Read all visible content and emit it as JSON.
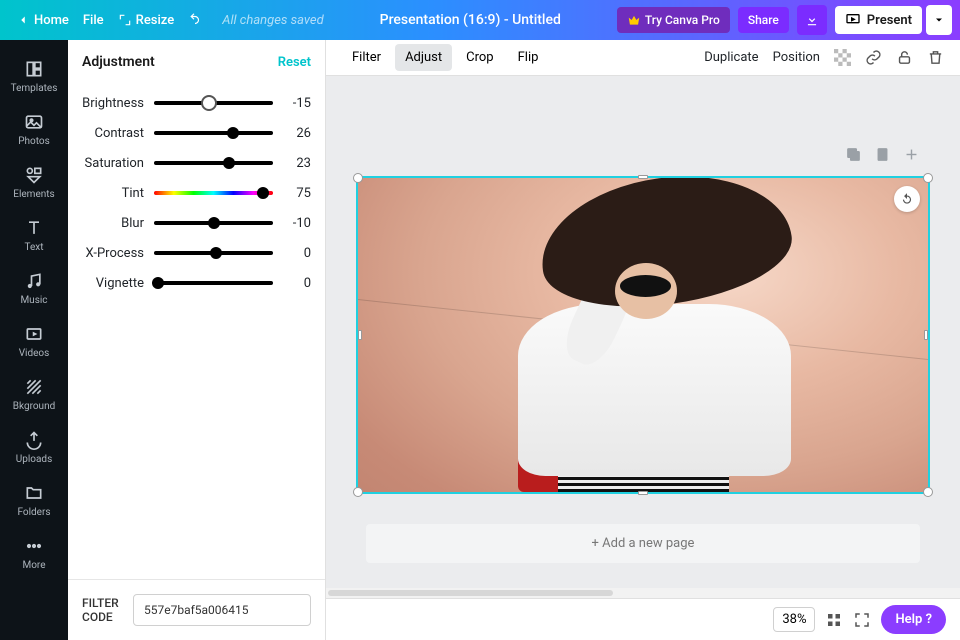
{
  "topbar": {
    "home": "Home",
    "file": "File",
    "resize": "Resize",
    "saved": "All changes saved",
    "title": "Presentation (16:9) - Untitled",
    "tryPro": "Try Canva Pro",
    "share": "Share",
    "present": "Present"
  },
  "leftbar": [
    {
      "key": "templates",
      "label": "Templates"
    },
    {
      "key": "photos",
      "label": "Photos"
    },
    {
      "key": "elements",
      "label": "Elements"
    },
    {
      "key": "text",
      "label": "Text"
    },
    {
      "key": "music",
      "label": "Music"
    },
    {
      "key": "videos",
      "label": "Videos"
    },
    {
      "key": "background",
      "label": "Bkground"
    },
    {
      "key": "uploads",
      "label": "Uploads"
    },
    {
      "key": "folders",
      "label": "Folders"
    },
    {
      "key": "more",
      "label": "More"
    }
  ],
  "panel": {
    "title": "Adjustment",
    "reset": "Reset",
    "sliders": [
      {
        "name": "Brightness",
        "value": -15,
        "pct": 46,
        "kind": "std"
      },
      {
        "name": "Contrast",
        "value": 26,
        "pct": 66,
        "kind": "std"
      },
      {
        "name": "Saturation",
        "value": 23,
        "pct": 63,
        "kind": "std"
      },
      {
        "name": "Tint",
        "value": 75,
        "pct": 92,
        "kind": "tint"
      },
      {
        "name": "Blur",
        "value": -10,
        "pct": 50,
        "kind": "std"
      },
      {
        "name": "X-Process",
        "value": 0,
        "pct": 52,
        "kind": "std"
      },
      {
        "name": "Vignette",
        "value": 0,
        "pct": 3,
        "kind": "std"
      }
    ],
    "filterCodeLabel": "FILTER CODE",
    "filterCode": "557e7baf5a006415"
  },
  "context": {
    "tabs": [
      "Filter",
      "Adjust",
      "Crop",
      "Flip"
    ],
    "active": "Adjust",
    "right": [
      "Duplicate",
      "Position"
    ]
  },
  "stage": {
    "addPage": "+ Add a new page"
  },
  "footer": {
    "zoom": "38%",
    "help": "Help ?"
  }
}
